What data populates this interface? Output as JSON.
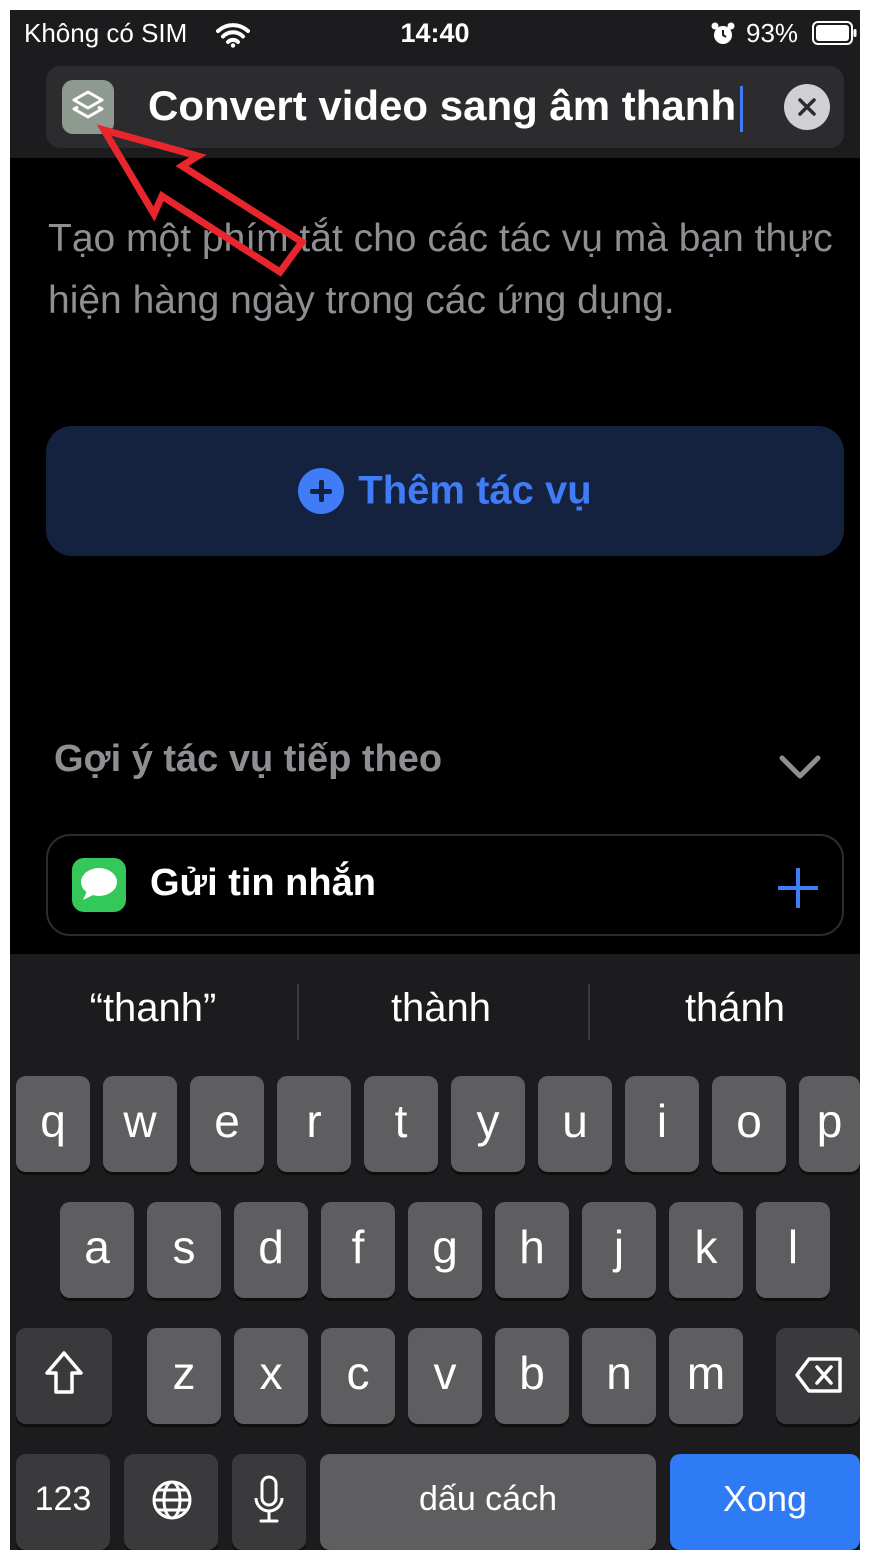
{
  "status_bar": {
    "carrier": "Không có SIM",
    "time": "14:40",
    "battery": "93%"
  },
  "header": {
    "shortcut_name": "Convert video sang âm thanh"
  },
  "intro_text": "Tạo một phím tắt cho các tác vụ mà bạn thực hiện hàng ngày trong các ứng dụng.",
  "add_action_label": "Thêm tác vụ",
  "suggestions": {
    "title": "Gợi ý tác vụ tiếp theo",
    "item": "Gửi tin nhắn"
  },
  "keyboard": {
    "predictions": [
      "“thanh”",
      "thành",
      "thánh"
    ],
    "row1": [
      "q",
      "w",
      "e",
      "r",
      "t",
      "y",
      "u",
      "i",
      "o",
      "p"
    ],
    "row2": [
      "a",
      "s",
      "d",
      "f",
      "g",
      "h",
      "j",
      "k",
      "l"
    ],
    "row3": [
      "z",
      "x",
      "c",
      "v",
      "b",
      "n",
      "m"
    ],
    "numbers_key": "123",
    "space_key": "dấu cách",
    "done_key": "Xong"
  },
  "colors": {
    "accent": "#3f7cf5",
    "annotation": "#e8262d",
    "background": "#000000"
  },
  "icons": [
    "wifi-icon",
    "alarm-icon",
    "battery-icon",
    "shortcut-app-icon",
    "clear-icon",
    "plus-circle-icon",
    "chevron-down-icon",
    "messages-app-icon",
    "plus-icon",
    "shift-icon",
    "delete-icon",
    "globe-icon",
    "microphone-icon",
    "red-arrow-annotation"
  ]
}
